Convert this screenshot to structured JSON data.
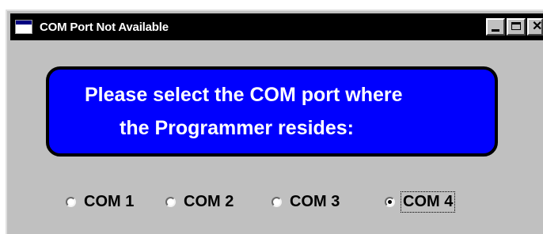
{
  "window": {
    "title": "COM Port Not Available",
    "icon": "window-icon",
    "controls": [
      "minimize",
      "maximize",
      "close"
    ]
  },
  "banner": {
    "line1": "Please select the COM port where",
    "line2": "the Programmer resides:",
    "background": "#0000fe"
  },
  "ports": {
    "selected": "COM 4",
    "options": [
      {
        "label": "COM 1",
        "checked": false
      },
      {
        "label": "COM 2",
        "checked": false
      },
      {
        "label": "COM 3",
        "checked": false
      },
      {
        "label": "COM 4",
        "checked": true
      }
    ]
  }
}
